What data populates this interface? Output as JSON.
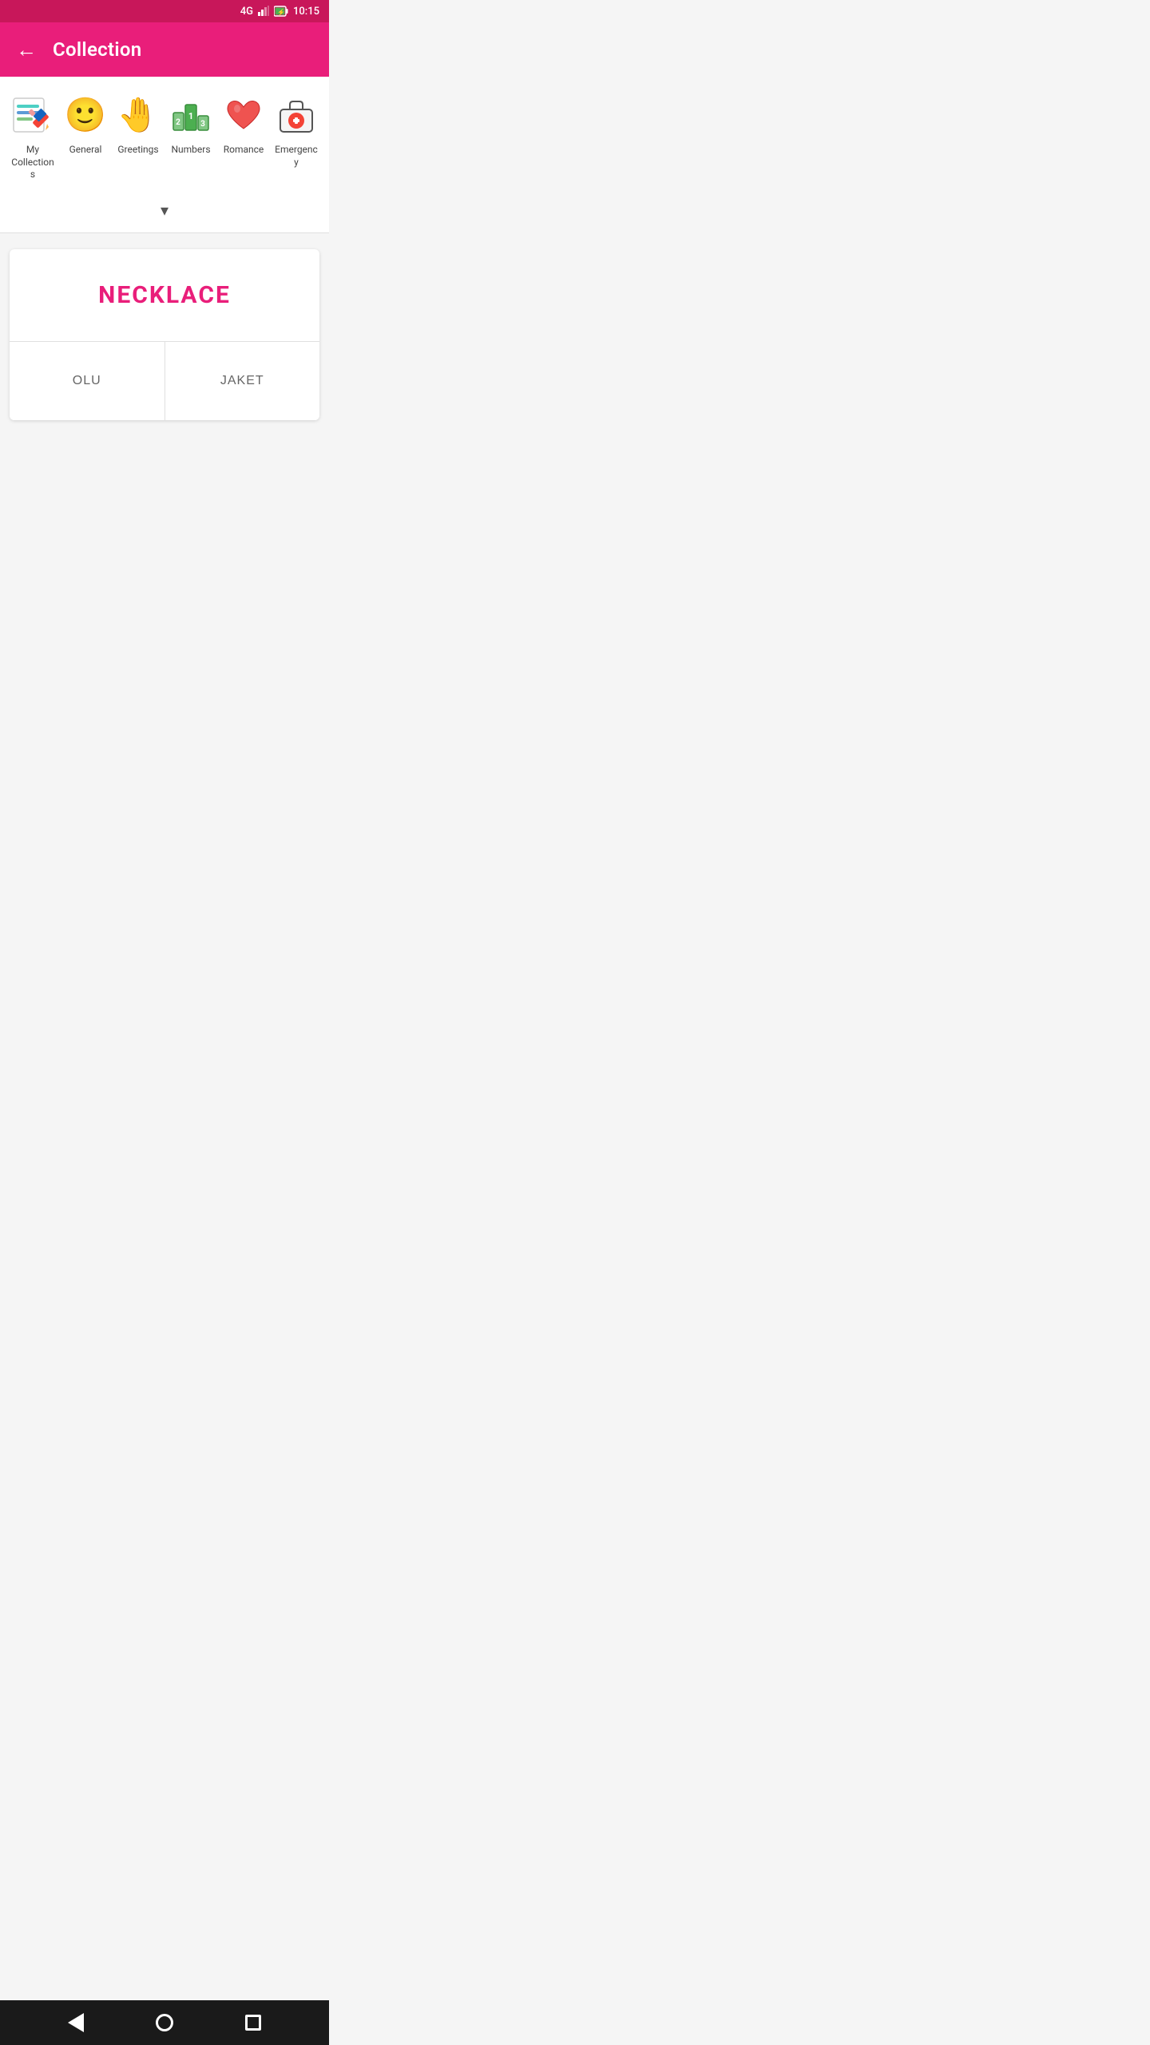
{
  "statusBar": {
    "signal": "4G",
    "time": "10:15"
  },
  "appBar": {
    "title": "Collection",
    "backLabel": "←"
  },
  "categories": [
    {
      "id": "my-collections",
      "label": "My Collections",
      "iconType": "notepad"
    },
    {
      "id": "general",
      "label": "General",
      "iconType": "emoji-face"
    },
    {
      "id": "greetings",
      "label": "Greetings",
      "iconType": "emoji-hand"
    },
    {
      "id": "numbers",
      "label": "Numbers",
      "iconType": "emoji-numbers"
    },
    {
      "id": "romance",
      "label": "Romance",
      "iconType": "emoji-heart"
    },
    {
      "id": "emergency",
      "label": "Emergency",
      "iconType": "emergency"
    }
  ],
  "card": {
    "word": "NECKLACE",
    "option1": "OLU",
    "option2": "JAKET"
  },
  "nav": {
    "back": "back",
    "home": "home",
    "recent": "recent"
  }
}
